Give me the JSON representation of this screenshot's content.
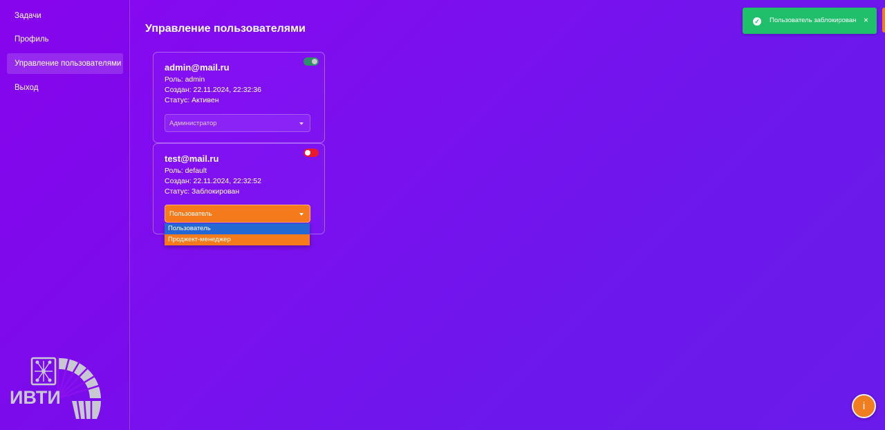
{
  "sidebar": {
    "items": [
      {
        "label": "Задачи"
      },
      {
        "label": "Профиль"
      },
      {
        "label": "Управление пользователями"
      },
      {
        "label": "Выход"
      }
    ],
    "logo_text": "ИВТИ"
  },
  "main": {
    "title": "Управление пользователями",
    "users": [
      {
        "email": "admin@mail.ru",
        "role_line": "Роль: admin",
        "created_line": "Создан: 22.11.2024, 22:32:36",
        "status_line": "Статус: Активен",
        "role_select": "Администратор",
        "toggle_color": "#2e8f6a"
      },
      {
        "email": "test@mail.ru",
        "role_line": "Роль: default",
        "created_line": "Создан: 22.11.2024, 22:32:52",
        "status_line": "Статус: Заблокирован",
        "role_select": "Пользователь",
        "toggle_color": "#e8192c",
        "options": [
          "Пользователь",
          "Проджект-менеджер"
        ]
      }
    ]
  },
  "toast": {
    "message": "Пользователь заблокирован",
    "close": "×",
    "check": "✓"
  },
  "info_button": {
    "label": "i"
  },
  "colors": {
    "accent_orange": "#f57a1c",
    "toast_green": "#20bf6b",
    "option_selected": "#2469d3"
  }
}
